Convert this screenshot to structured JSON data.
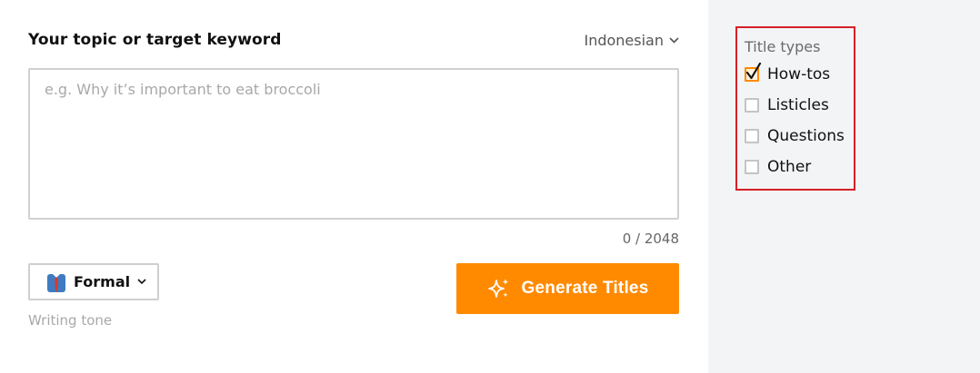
{
  "form": {
    "label": "Your topic or target keyword",
    "language": "Indonesian",
    "topic_value": "",
    "topic_placeholder": "e.g. Why it’s important to eat broccoli",
    "char_count": "0 / 2048"
  },
  "tone": {
    "value": "Formal",
    "caption": "Writing tone",
    "icon": "necktie-icon"
  },
  "generate": {
    "label": "Generate Titles",
    "icon": "sparkles-icon",
    "color": "#ff8a00"
  },
  "title_types": {
    "heading": "Title types",
    "options": [
      {
        "label": "How-tos",
        "checked": true
      },
      {
        "label": "Listicles",
        "checked": false
      },
      {
        "label": "Questions",
        "checked": false
      },
      {
        "label": "Other",
        "checked": false
      }
    ],
    "highlight_color": "#d61f26"
  }
}
